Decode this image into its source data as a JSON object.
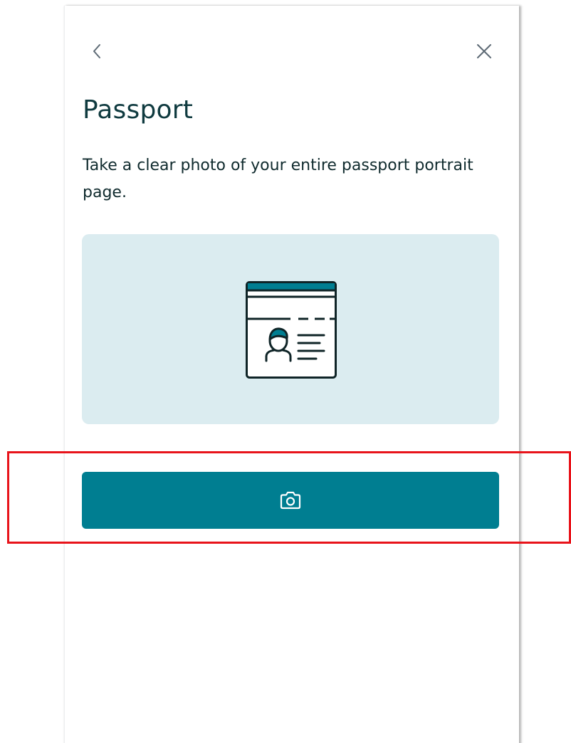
{
  "header": {
    "back_icon": "chevron-left-icon",
    "close_icon": "close-icon"
  },
  "main": {
    "title": "Passport",
    "instructions": "Take a clear photo of your entire passport portrait page.",
    "illustration_icon": "passport-document-icon"
  },
  "actions": {
    "capture_icon": "camera-icon"
  },
  "colors": {
    "accent": "#007e91",
    "illustration_bg": "#dbecf0",
    "title_text": "#0f3a3f",
    "highlight": "#e8131a"
  }
}
